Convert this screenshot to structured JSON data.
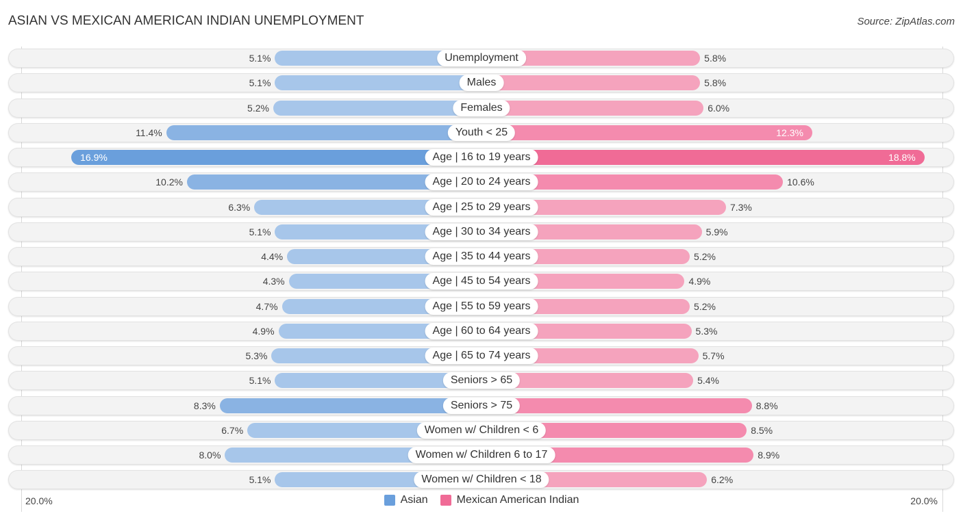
{
  "header": {
    "title": "ASIAN VS MEXICAN AMERICAN INDIAN UNEMPLOYMENT",
    "source": "Source: ZipAtlas.com"
  },
  "legend": {
    "asian": {
      "label": "Asian",
      "color": "#6a9fdc"
    },
    "mexican": {
      "label": "Mexican American Indian",
      "color": "#f06b96"
    }
  },
  "axis": {
    "left_label": "20.0%",
    "right_label": "20.0%"
  },
  "chart_data": {
    "type": "bar",
    "orientation": "horizontal-diverging",
    "title": "ASIAN VS MEXICAN AMERICAN INDIAN UNEMPLOYMENT",
    "xlabel": "",
    "ylabel": "",
    "xlim": [
      0,
      20
    ],
    "units": "%",
    "legend_position": "bottom-center",
    "categories": [
      "Unemployment",
      "Males",
      "Females",
      "Youth < 25",
      "Age | 16 to 19 years",
      "Age | 20 to 24 years",
      "Age | 25 to 29 years",
      "Age | 30 to 34 years",
      "Age | 35 to 44 years",
      "Age | 45 to 54 years",
      "Age | 55 to 59 years",
      "Age | 60 to 64 years",
      "Age | 65 to 74 years",
      "Seniors > 65",
      "Seniors > 75",
      "Women w/ Children < 6",
      "Women w/ Children 6 to 17",
      "Women w/ Children < 18"
    ],
    "series": [
      {
        "name": "Asian",
        "side": "left",
        "color": "#6a9fdc",
        "values": [
          5.1,
          5.1,
          5.2,
          11.4,
          16.9,
          10.2,
          6.3,
          5.1,
          4.4,
          4.3,
          4.7,
          4.9,
          5.3,
          5.1,
          8.3,
          6.7,
          8.0,
          5.1
        ],
        "labels": [
          "5.1%",
          "5.1%",
          "5.2%",
          "11.4%",
          "16.9%",
          "10.2%",
          "6.3%",
          "5.1%",
          "4.4%",
          "4.3%",
          "4.7%",
          "4.9%",
          "5.3%",
          "5.1%",
          "8.3%",
          "6.7%",
          "8.0%",
          "5.1%"
        ]
      },
      {
        "name": "Mexican American Indian",
        "side": "right",
        "color": "#f06b96",
        "values": [
          5.8,
          5.8,
          6.0,
          12.3,
          18.8,
          10.6,
          7.3,
          5.9,
          5.2,
          4.9,
          5.2,
          5.3,
          5.7,
          5.4,
          8.8,
          8.5,
          8.9,
          6.2
        ],
        "labels": [
          "5.8%",
          "5.8%",
          "6.0%",
          "12.3%",
          "18.8%",
          "10.6%",
          "7.3%",
          "5.9%",
          "5.2%",
          "4.9%",
          "5.2%",
          "5.3%",
          "5.7%",
          "5.4%",
          "8.8%",
          "8.5%",
          "8.9%",
          "6.2%"
        ]
      }
    ]
  }
}
